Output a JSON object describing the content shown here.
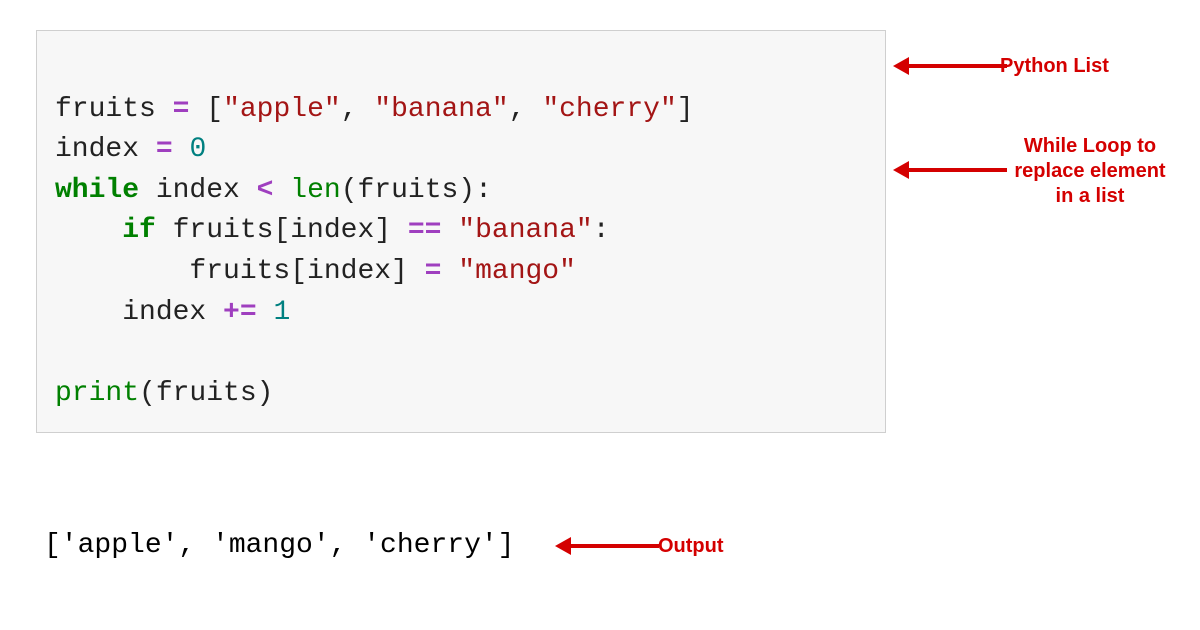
{
  "code": {
    "l1_var": "fruits ",
    "l1_eq": "=",
    "l1_sp": " ",
    "l1_br_open": "[",
    "l1_s1": "\"apple\"",
    "l1_c1": ", ",
    "l1_s2": "\"banana\"",
    "l1_c2": ", ",
    "l1_s3": "\"cherry\"",
    "l1_br_close": "]",
    "l2_var": "index ",
    "l2_eq": "=",
    "l2_sp": " ",
    "l2_num": "0",
    "l3_kw": "while",
    "l3_mid": " index ",
    "l3_lt": "<",
    "l3_sp": " ",
    "l3_fn": "len",
    "l3_tail": "(fruits):",
    "l4_indent": "    ",
    "l4_kw": "if",
    "l4_mid": " fruits[index] ",
    "l4_eqeq": "==",
    "l4_sp": " ",
    "l4_str": "\"banana\"",
    "l4_colon": ":",
    "l5_indent": "        ",
    "l5_lhs": "fruits[index] ",
    "l5_eq": "=",
    "l5_sp": " ",
    "l5_str": "\"mango\"",
    "l6_indent": "    ",
    "l6_lhs": "index ",
    "l6_op": "+=",
    "l6_sp": " ",
    "l6_num": "1",
    "blank": "",
    "l8_fn": "print",
    "l8_tail": "(fruits)"
  },
  "output": "['apple', 'mango', 'cherry']",
  "annotations": {
    "list_label": "Python List",
    "loop_label": "While Loop to\nreplace element\nin a list",
    "output_label": "Output"
  }
}
